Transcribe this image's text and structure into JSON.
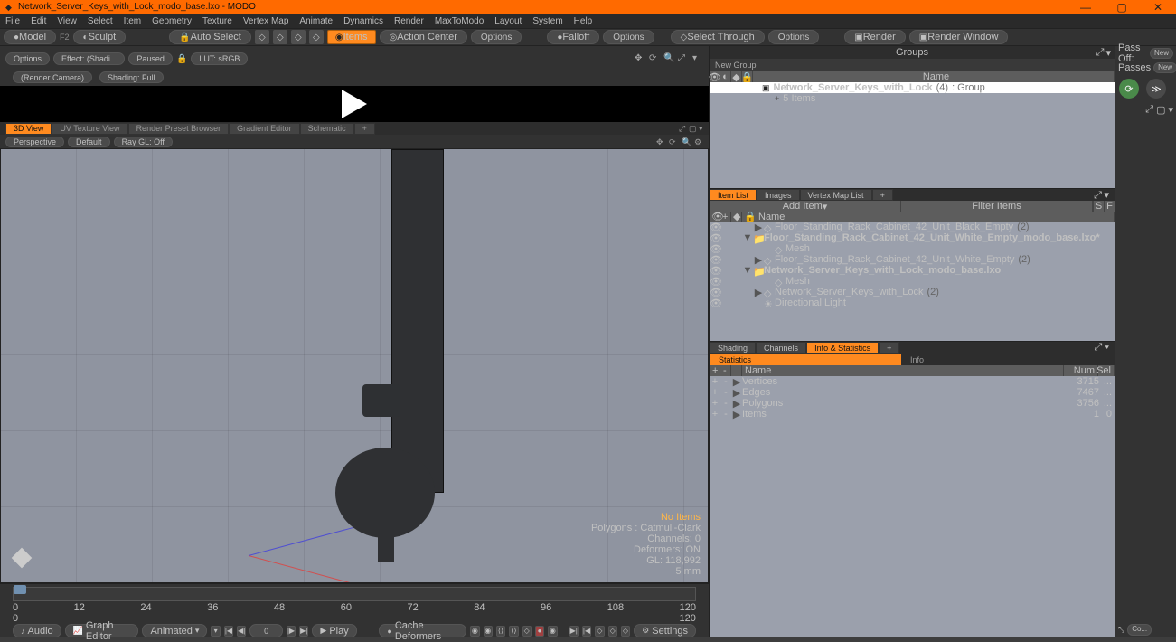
{
  "title": "Network_Server_Keys_with_Lock_modo_base.lxo - MODO",
  "menubar": [
    "File",
    "Edit",
    "View",
    "Select",
    "Item",
    "Geometry",
    "Texture",
    "Vertex Map",
    "Animate",
    "Dynamics",
    "Render",
    "MaxToModo",
    "Layout",
    "System",
    "Help"
  ],
  "toolbar": {
    "model": "Model",
    "model_shortcut": "F2",
    "sculpt": "Sculpt",
    "auto_select": "Auto Select",
    "items": "Items",
    "action_center": "Action Center",
    "options": "Options",
    "falloff": "Falloff",
    "options2": "Options",
    "select_through": "Select Through",
    "options3": "Options",
    "render": "Render",
    "render_window": "Render Window"
  },
  "preview": {
    "options": "Options",
    "effect": "Effect: (Shadi...",
    "paused": "Paused",
    "lut": "LUT: sRGB",
    "render_camera": "(Render Camera)",
    "shading": "Shading: Full"
  },
  "viewtabs": [
    "3D View",
    "UV Texture View",
    "Render Preset Browser",
    "Gradient Editor",
    "Schematic",
    "+"
  ],
  "vp_ctl": {
    "perspective": "Perspective",
    "default": "Default",
    "raygl": "Ray GL: Off"
  },
  "vp_info": {
    "noitems": "No Items",
    "polys": "Polygons : Catmull-Clark",
    "channels": "Channels: 0",
    "deformers": "Deformers: ON",
    "gl": "GL: 118,992",
    "unit": "5 mm"
  },
  "timeline": {
    "ticks": [
      "0",
      "12",
      "24",
      "36",
      "48",
      "60",
      "72",
      "84",
      "96",
      "108",
      "120"
    ],
    "ticks2": [
      "0",
      "",
      "",
      "",
      "",
      "",
      "",
      "",
      "",
      "",
      "120"
    ],
    "audio": "Audio",
    "graph": "Graph Editor",
    "animated": "Animated",
    "frame": "0",
    "play": "Play",
    "cache": "Cache Deformers",
    "settings": "Settings"
  },
  "groups": {
    "title": "Groups",
    "new_group": "New Group",
    "name_col": "Name",
    "rows": [
      {
        "name": "Network_Server_Keys_with_Lock",
        "count": "(4)",
        "type": ": Group"
      },
      {
        "name": "5 Items",
        "indent": 1
      }
    ]
  },
  "itemlist": {
    "tabs": [
      "Item List",
      "Images",
      "Vertex Map List",
      "+"
    ],
    "add": "Add Item",
    "filter": "Filter Items",
    "name_col": "Name",
    "rows": [
      {
        "name": "Floor_Standing_Rack_Cabinet_42_Unit_Black_Empty",
        "suffix": "(2)",
        "arrow": "▶",
        "icon": "mesh"
      },
      {
        "name": "Floor_Standing_Rack_Cabinet_42_Unit_White_Empty_modo_base.lxo*",
        "arrow": "▼",
        "icon": "folder",
        "bold": true,
        "indent": -1
      },
      {
        "name": "Mesh",
        "icon": "mesh",
        "indent": 1
      },
      {
        "name": "Floor_Standing_Rack_Cabinet_42_Unit_White_Empty",
        "suffix": "(2)",
        "arrow": "▶",
        "icon": "mesh"
      },
      {
        "name": "Network_Server_Keys_with_Lock_modo_base.lxo",
        "arrow": "▼",
        "icon": "folder",
        "bold": true,
        "indent": -1
      },
      {
        "name": "Mesh",
        "icon": "mesh",
        "indent": 1
      },
      {
        "name": "Network_Server_Keys_with_Lock",
        "suffix": "(2)",
        "arrow": "▶",
        "icon": "mesh"
      },
      {
        "name": "Directional Light",
        "icon": "light"
      }
    ]
  },
  "info": {
    "tabs": [
      "Shading",
      "Channels",
      "Info & Statistics",
      "+"
    ],
    "stat": "Statistics",
    "info_tab": "Info",
    "cols": {
      "name": "Name",
      "num": "Num",
      "sel": "Sel"
    },
    "rows": [
      {
        "name": "Vertices",
        "num": "3715",
        "sel": "..."
      },
      {
        "name": "Edges",
        "num": "7467",
        "sel": "..."
      },
      {
        "name": "Polygons",
        "num": "3756",
        "sel": "..."
      },
      {
        "name": "Items",
        "num": "1",
        "sel": "0"
      }
    ]
  },
  "farright": {
    "pass_off": "Pass Off:",
    "new": "New",
    "passes": "Passes",
    "co": "Co..."
  }
}
